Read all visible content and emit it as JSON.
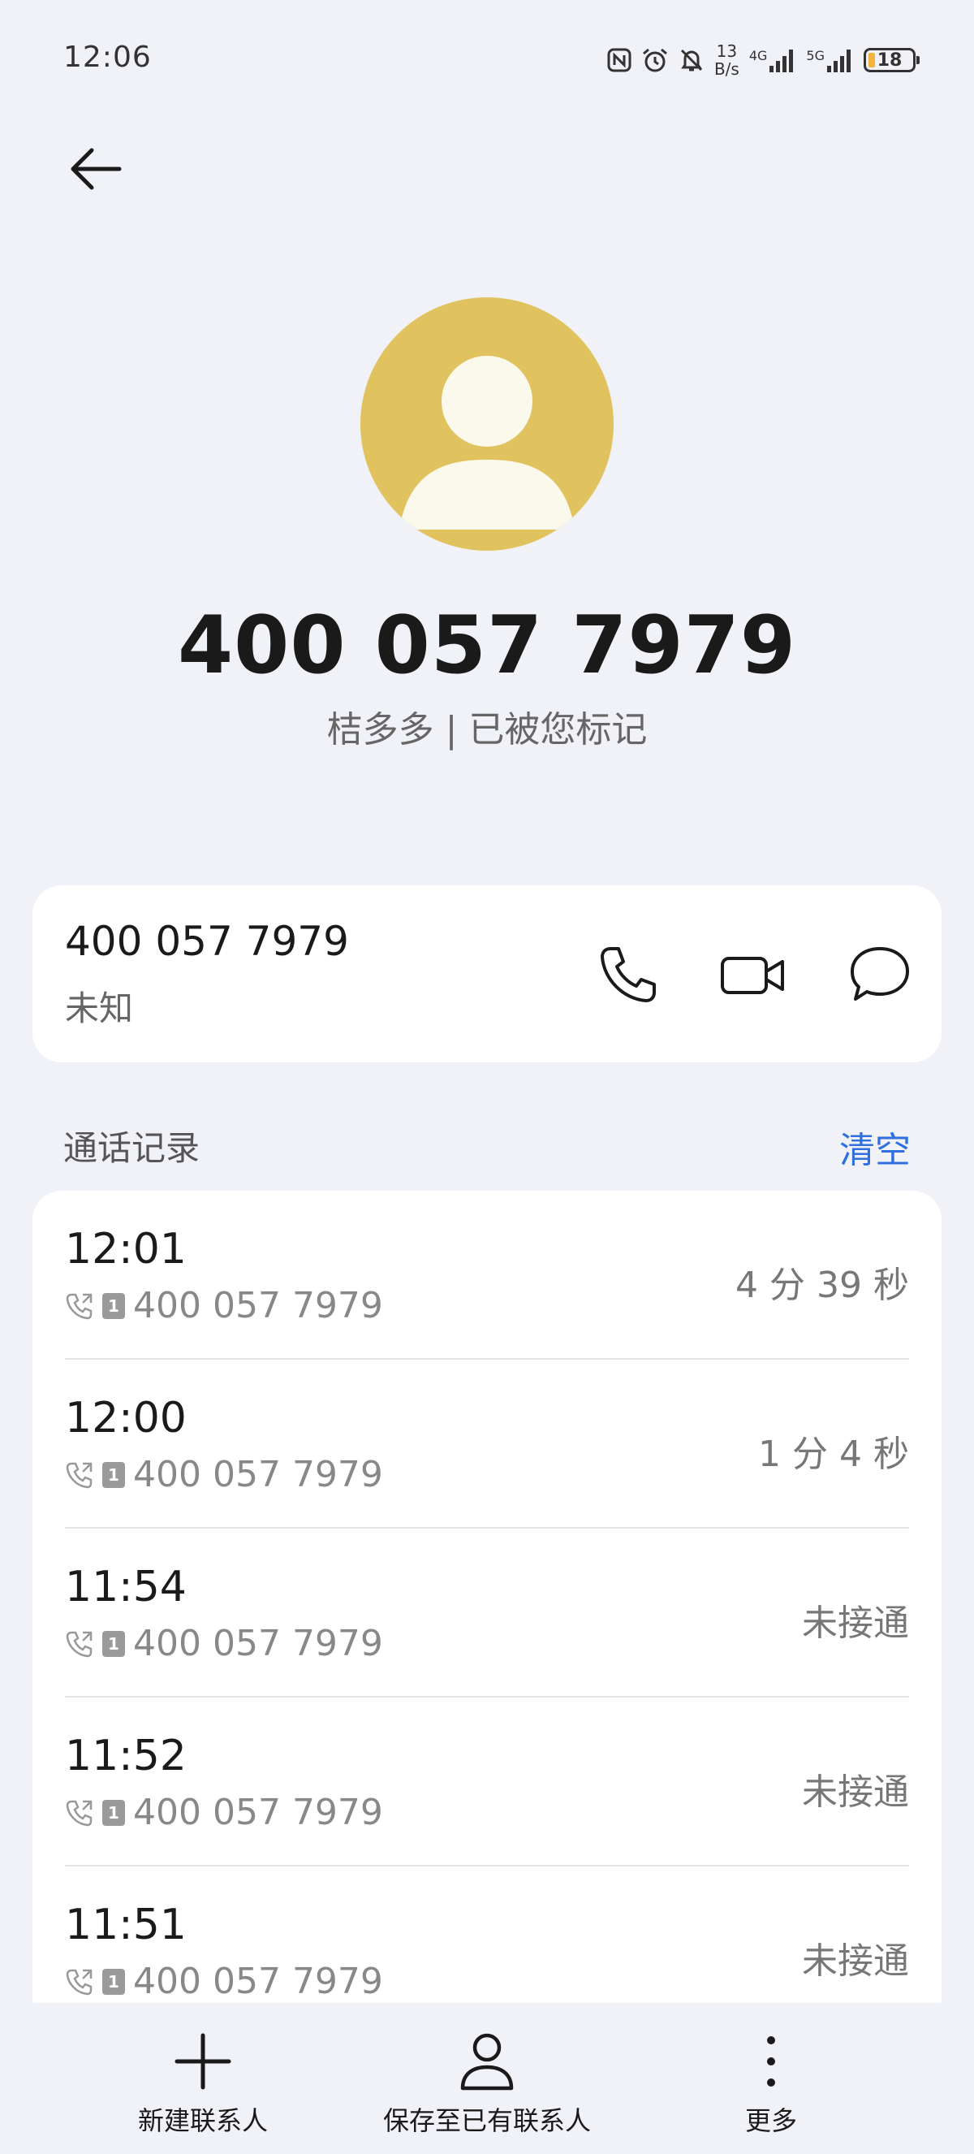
{
  "status_bar": {
    "time": "12:06",
    "speed_value": "13",
    "speed_unit": "B/s",
    "network_1": "4G",
    "network_2": "5G",
    "battery": "18",
    "icons": [
      "nfc-icon",
      "alarm-icon",
      "mute-icon",
      "signal-icon",
      "battery-icon"
    ]
  },
  "header": {
    "back_icon": "arrow-left-icon"
  },
  "profile": {
    "avatar_icon": "person-icon",
    "avatar_color": "#e0c35f",
    "number": "400 057 7979",
    "subtitle": "桔多多 | 已被您标记"
  },
  "contact_card": {
    "number": "400 057 7979",
    "label": "未知",
    "actions": [
      "phone-icon",
      "video-icon",
      "message-icon"
    ]
  },
  "call_log": {
    "title": "通话记录",
    "clear_label": "清空",
    "accent_color": "#2f6fdf",
    "entries": [
      {
        "time": "12:01",
        "sim": "1",
        "number": "400 057 7979",
        "status": "4 分 39 秒"
      },
      {
        "time": "12:00",
        "sim": "1",
        "number": "400 057 7979",
        "status": "1 分 4 秒"
      },
      {
        "time": "11:54",
        "sim": "1",
        "number": "400 057 7979",
        "status": "未接通"
      },
      {
        "time": "11:52",
        "sim": "1",
        "number": "400 057 7979",
        "status": "未接通"
      },
      {
        "time": "11:51",
        "sim": "1",
        "number": "400 057 7979",
        "status": "未接通"
      }
    ]
  },
  "bottom_bar": {
    "new_contact": "新建联系人",
    "save_existing": "保存至已有联系人",
    "more": "更多"
  }
}
